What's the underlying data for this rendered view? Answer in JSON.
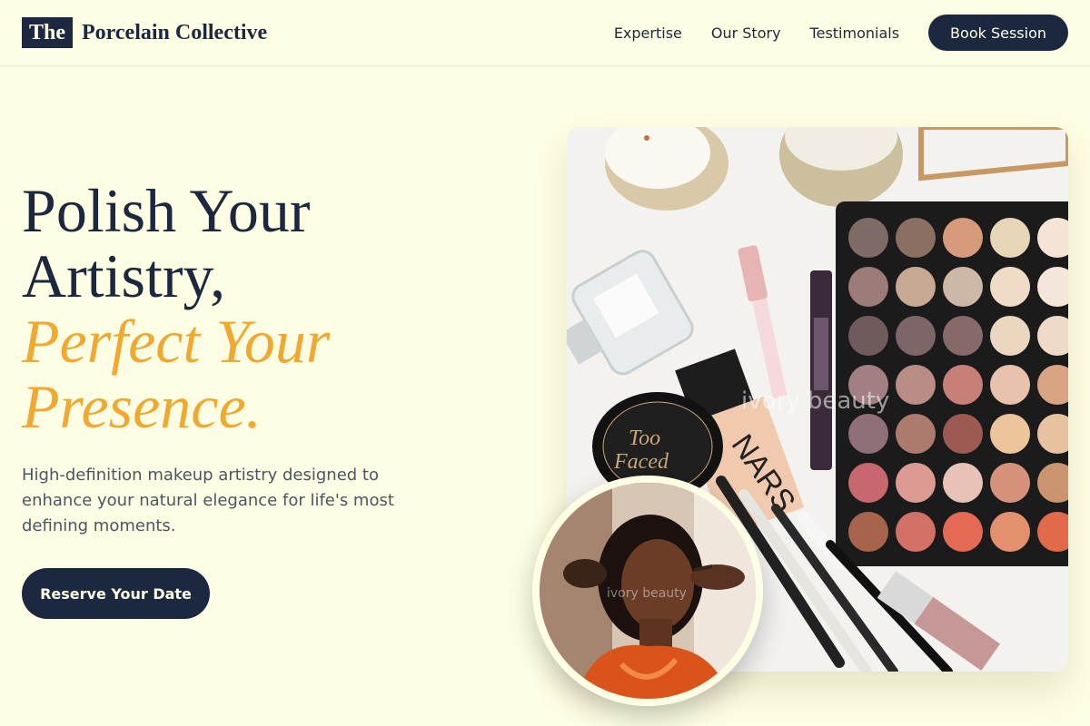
{
  "nav": {
    "brand_mark": "The",
    "brand_name": "Porcelain Collective",
    "links": [
      {
        "label": "Expertise"
      },
      {
        "label": "Our Story"
      },
      {
        "label": "Testimonials"
      }
    ],
    "cta_label": "Book Session"
  },
  "hero": {
    "title_line1": "Polish Your",
    "title_line2": "Artistry,",
    "title_accent_line1": "Perfect Your",
    "title_accent_line2": "Presence.",
    "subtitle": "High-definition makeup artistry designed to enhance your natural elegance for life's most defining moments.",
    "cta_label": "Reserve Your Date"
  },
  "images": {
    "main_watermark": "ivory beauty",
    "round_watermark": "ivory beauty",
    "compact_label_top": "Too",
    "compact_label_bottom": "Faced",
    "foundation_label": "NARS"
  },
  "colors": {
    "background": "#fefee4",
    "primary": "#1c2840",
    "accent": "#f0a830",
    "body_text": "#4b5563"
  }
}
